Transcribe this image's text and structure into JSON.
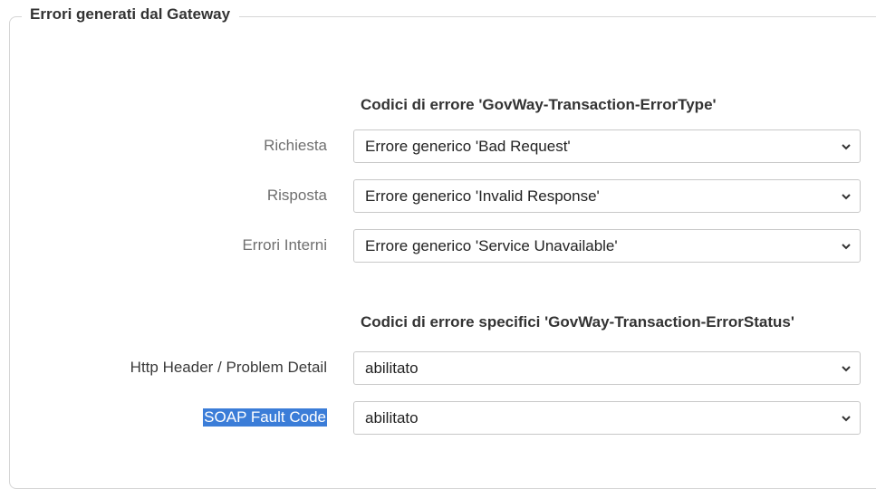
{
  "fieldset": {
    "legend": "Errori generati dal Gateway"
  },
  "section1": {
    "title": "Codici di errore 'GovWay-Transaction-ErrorType'",
    "rows": [
      {
        "label": "Richiesta",
        "value": "Errore generico 'Bad Request'"
      },
      {
        "label": "Risposta",
        "value": "Errore generico 'Invalid Response'"
      },
      {
        "label": "Errori Interni",
        "value": "Errore generico 'Service Unavailable'"
      }
    ]
  },
  "section2": {
    "title": "Codici di errore specifici 'GovWay-Transaction-ErrorStatus'",
    "rows": [
      {
        "label": "Http Header / Problem Detail",
        "value": "abilitato"
      },
      {
        "label": "SOAP Fault Code",
        "value": "abilitato"
      }
    ]
  },
  "icons": {
    "dropdown": "chevron-down-icon"
  },
  "colors": {
    "selection_highlight": "#3b7dd8",
    "border": "#d5d5d5"
  }
}
